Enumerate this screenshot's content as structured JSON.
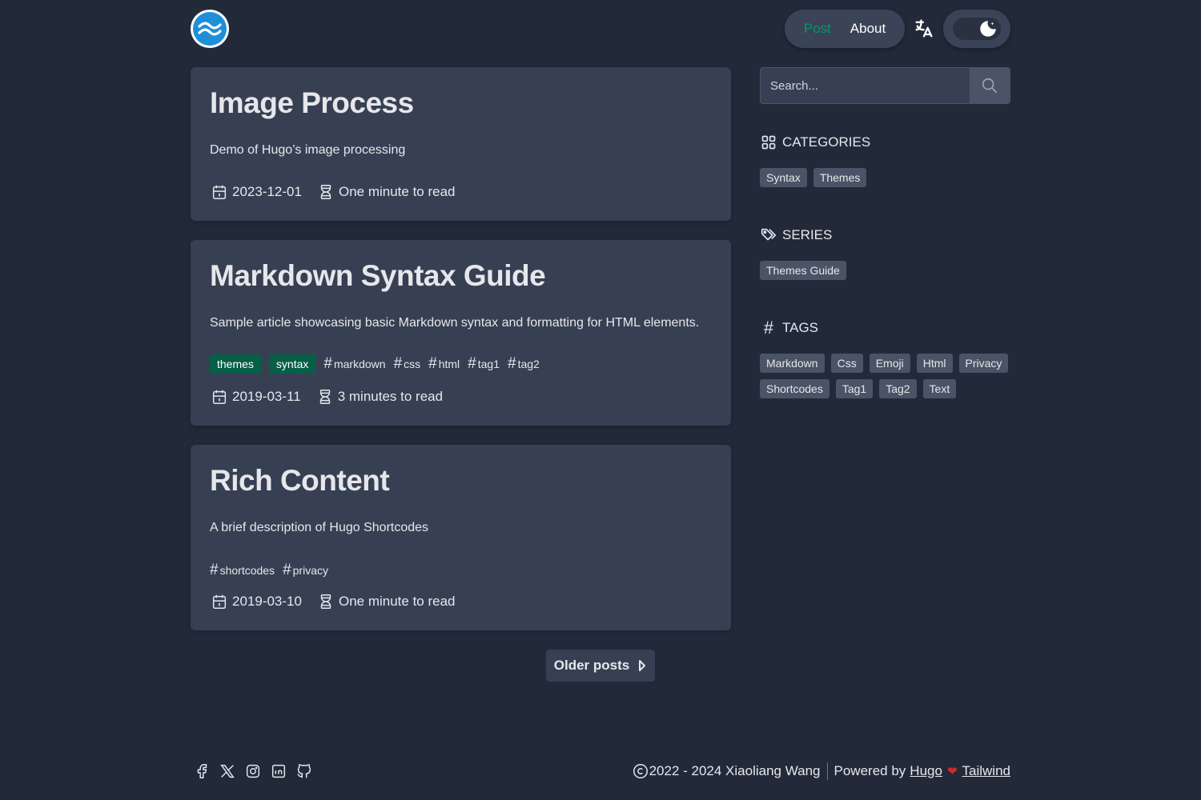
{
  "nav": {
    "post_label": "Post",
    "about_label": "About"
  },
  "search": {
    "placeholder": "Search..."
  },
  "posts": [
    {
      "title": "Image Process",
      "description": "Demo of Hugo’s image processing",
      "date": "2023-12-01",
      "reading_time": "One minute to read"
    },
    {
      "title": "Markdown Syntax Guide",
      "description": "Sample article showcasing basic Markdown syntax and formatting for HTML elements.",
      "categories": [
        "themes",
        "syntax"
      ],
      "tags": [
        "markdown",
        "css",
        "html",
        "tag1",
        "tag2"
      ],
      "date": "2019-03-11",
      "reading_time": "3 minutes to read"
    },
    {
      "title": "Rich Content",
      "description": "A brief description of Hugo Shortcodes",
      "tags": [
        "shortcodes",
        "privacy"
      ],
      "date": "2019-03-10",
      "reading_time": "One minute to read"
    }
  ],
  "pagination": {
    "older_label": "Older posts"
  },
  "sidebar": {
    "categories": {
      "heading": "CATEGORIES",
      "items": [
        "Syntax",
        "Themes"
      ]
    },
    "series": {
      "heading": "SERIES",
      "items": [
        "Themes Guide"
      ]
    },
    "tags": {
      "heading": "TAGS",
      "items": [
        "Markdown",
        "Css",
        "Emoji",
        "Html",
        "Privacy",
        "Shortcodes",
        "Tag1",
        "Tag2",
        "Text"
      ]
    }
  },
  "footer": {
    "copyright": "2022 - 2024 Xiaoliang Wang",
    "powered_by": "Powered by",
    "hugo_link": "Hugo",
    "tailwind_link": "Tailwind",
    "social_icons": [
      "facebook-icon",
      "x-icon",
      "instagram-icon",
      "linkedin-icon",
      "github-icon"
    ]
  },
  "colors": {
    "background": "#222a3a",
    "card": "#374053",
    "accent": "#059669",
    "category_badge": "#065f46",
    "heart": "#dc2626"
  }
}
